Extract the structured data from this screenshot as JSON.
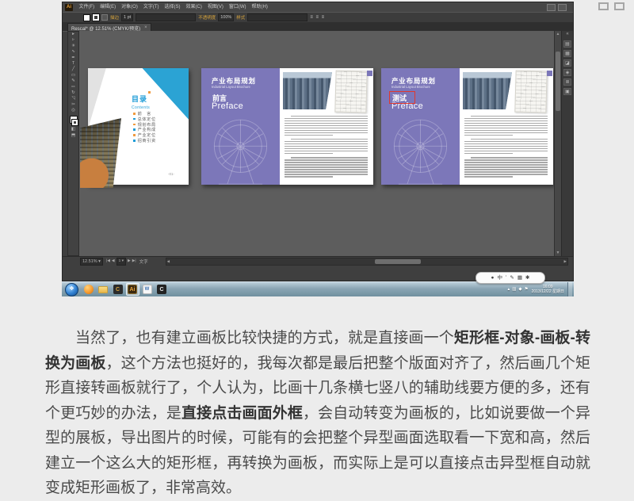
{
  "window": {
    "logo": "Ai",
    "menu_items": [
      "文件(F)",
      "编辑(E)",
      "对象(O)",
      "文字(T)",
      "选择(S)",
      "效果(C)",
      "视图(V)",
      "窗口(W)",
      "帮助(H)"
    ],
    "document_tab": {
      "title": "Rescal* @ 12.51% (CMYK/预览)",
      "close": "×"
    },
    "control_bar": {
      "stroke_link": "描边",
      "stroke_value": "1 pt",
      "opacity_link": "不透明度",
      "opacity_value": "100%",
      "style_link": "样式",
      "align_glyphs": "≡ ≡ ≡"
    },
    "tools": [
      {
        "name": "selection",
        "glyph": "▸"
      },
      {
        "name": "direct-selection",
        "glyph": "▹"
      },
      {
        "name": "magic-wand",
        "glyph": "✳"
      },
      {
        "name": "lasso",
        "glyph": "∿"
      },
      {
        "name": "pen",
        "glyph": "✒"
      },
      {
        "name": "type",
        "glyph": "T"
      },
      {
        "name": "line-segment",
        "glyph": "╱"
      },
      {
        "name": "rectangle",
        "glyph": "▭"
      },
      {
        "name": "paintbrush",
        "glyph": "✎"
      },
      {
        "name": "pencil",
        "glyph": "✏"
      },
      {
        "name": "rotate",
        "glyph": "↻"
      },
      {
        "name": "scale",
        "glyph": "◹"
      },
      {
        "name": "scissors",
        "glyph": "✂"
      },
      {
        "name": "zoom",
        "glyph": "◎"
      }
    ],
    "dock_icons": [
      {
        "name": "color-panel",
        "glyph": "▤"
      },
      {
        "name": "swatches-panel",
        "glyph": "▦"
      },
      {
        "name": "brushes-panel",
        "glyph": "◪"
      },
      {
        "name": "symbols-panel",
        "glyph": "◈"
      },
      {
        "name": "layers-panel",
        "glyph": "≣"
      },
      {
        "name": "artboards-panel",
        "glyph": "▣"
      }
    ]
  },
  "status_bar": {
    "zoom_level": "12.51%",
    "artboard_number": "1",
    "tool_status": "文字"
  },
  "artboards": {
    "cover": {
      "logo_cn": "目录",
      "logo_en": "Contents",
      "items": [
        {
          "label": "前　言"
        },
        {
          "label": "总体定位"
        },
        {
          "label": "规划布局"
        },
        {
          "label": "产业构成"
        },
        {
          "label": "产业定位"
        },
        {
          "label": "招商引资"
        }
      ],
      "page_number": "-01-"
    },
    "spreads": [
      {
        "title": "产业布局规划",
        "subtitle": "Industrial Layout Brochure",
        "heading": "前言",
        "heading_en": "Preface"
      },
      {
        "title": "产业布局规划",
        "subtitle": "Industrial Layout Brochure",
        "heading": "测试",
        "heading_en": "Preface"
      }
    ]
  },
  "taskbar": {
    "start_glyph": "❖",
    "icons": [
      {
        "name": "browser",
        "label": "",
        "style": "sphere"
      },
      {
        "name": "explorer",
        "label": "",
        "style": "folder"
      },
      {
        "name": "c-editor",
        "label": "C",
        "style": "tile-gold"
      },
      {
        "name": "illustrator",
        "label": "Ai",
        "style": "tile-ai",
        "active": true
      },
      {
        "name": "notes",
        "label": "W",
        "style": "tile-white"
      },
      {
        "name": "c-app",
        "label": "C",
        "style": "tile-dark"
      }
    ],
    "tray_glyphs": [
      "▴",
      "▥",
      "◆",
      "⚑"
    ],
    "clock_time": "16:09",
    "clock_date": "2013/12/22 星期日"
  },
  "ime": {
    "glyphs": [
      "●",
      "中",
      "ʼ",
      "✎",
      "▦",
      "✱"
    ]
  },
  "article": {
    "segments": [
      {
        "text": "当然了，也有建立画板比较快捷的方式，就是直接画一个",
        "bold": false
      },
      {
        "text": "矩形框-对象-画板-转换为画板",
        "bold": true
      },
      {
        "text": "，这个方法也挺好的，我每次都是最后把整个版面对齐了，然后画几个矩形直接转画板就行了，个人认为，比画十几条横七竖八的辅助线要方便的多，还有个更巧妙的办法，是",
        "bold": false
      },
      {
        "text": "直接点击画面外框",
        "bold": true
      },
      {
        "text": "，会自动转变为画板的，比如说要做一个异型的展板，导出图片的时候，可能有的会把整个异型画面选取看一下宽和高，然后建立一个这么大的矩形框，再转换为画板，而实际上是可以直接点击异型框自动就变成矩形画板了，非常高效。",
        "bold": false
      }
    ]
  }
}
